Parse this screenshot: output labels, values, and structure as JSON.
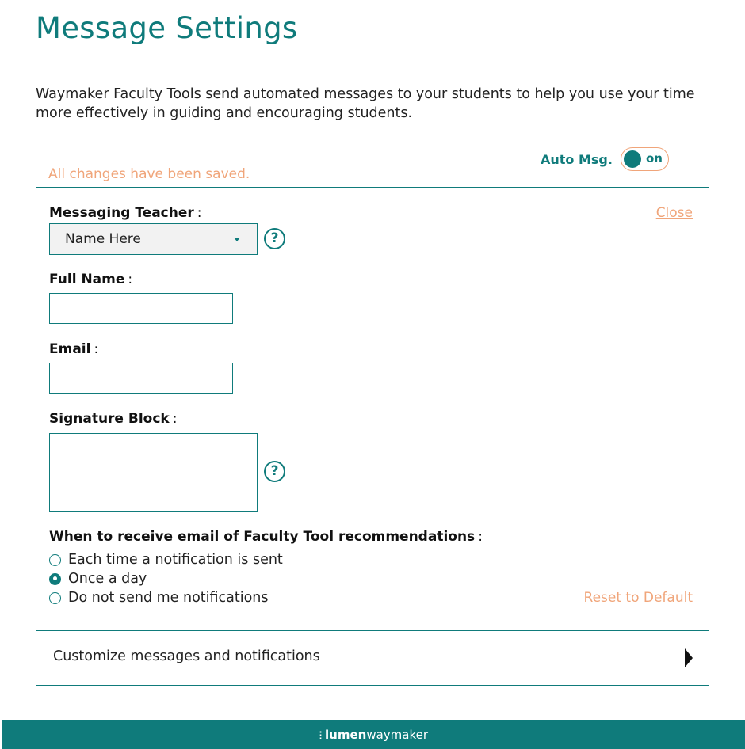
{
  "page": {
    "title": "Message Settings",
    "intro": "Waymaker Faculty Tools send automated messages to your students to help you use your time more effectively in guiding and encouraging students.",
    "saved_status": "All changes have been saved."
  },
  "auto_msg": {
    "label": "Auto Msg.",
    "state": "on"
  },
  "form": {
    "close_label": "Close",
    "messaging_teacher": {
      "label": "Messaging Teacher",
      "selected": "Name Here"
    },
    "full_name": {
      "label": "Full Name",
      "value": ""
    },
    "email": {
      "label": "Email",
      "value": ""
    },
    "signature": {
      "label": "Signature Block",
      "value": ""
    },
    "help_glyph": "?",
    "colon": ":",
    "frequency": {
      "label": "When to receive email of Faculty Tool recommendations",
      "options": [
        {
          "label": "Each time a notification is sent",
          "checked": false
        },
        {
          "label": "Once a day",
          "checked": true
        },
        {
          "label": "Do not send me notifications",
          "checked": false
        }
      ]
    },
    "reset_label": "Reset to Default"
  },
  "customize": {
    "label": "Customize messages and notifications"
  },
  "footer": {
    "brand_lumen": "lumen",
    "brand_waymaker": "waymaker"
  },
  "colors": {
    "accent": "#0f7b7b",
    "link": "#f0a57a"
  },
  "icons": {
    "help": "question-circle-icon",
    "dropdown": "chevron-down-icon",
    "expand": "caret-right-icon",
    "logo": "lumen-logo-icon"
  }
}
